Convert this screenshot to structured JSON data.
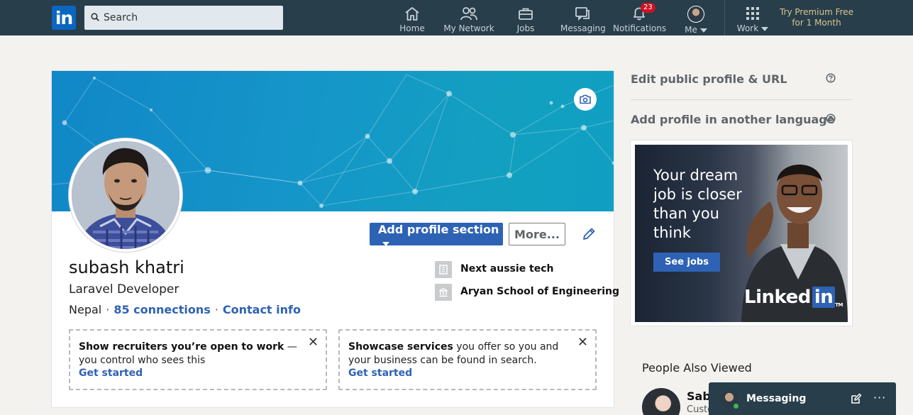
{
  "nav": {
    "logo": "in",
    "search_placeholder": "Search",
    "items": [
      {
        "label": "Home",
        "icon": "home-icon"
      },
      {
        "label": "My Network",
        "icon": "network-icon"
      },
      {
        "label": "Jobs",
        "icon": "briefcase-icon"
      },
      {
        "label": "Messaging",
        "icon": "messaging-icon"
      },
      {
        "label": "Notifications",
        "icon": "bell-icon"
      },
      {
        "label": "Me",
        "icon": "avatar"
      },
      {
        "label": "Work",
        "icon": "grid-icon"
      }
    ],
    "notifications_count": "23",
    "premium_line1": "Try Premium Free",
    "premium_line2": "for 1 Month"
  },
  "profile": {
    "name": "subash khatri",
    "headline": "Laravel Developer",
    "location": "Nepal",
    "connections": "85 connections",
    "contact": "Contact info",
    "add_section_label": "Add profile section",
    "more_label": "More...",
    "experience": [
      {
        "name": "Next aussie tech",
        "icon": "company-icon"
      },
      {
        "name": "Aryan School of Engineering",
        "icon": "school-icon"
      }
    ],
    "promos": [
      {
        "bold": "Show recruiters you’re open to work",
        "rest": " — you control who sees this",
        "cta": "Get started"
      },
      {
        "bold": "Showcase services",
        "rest": " you offer so you and your business can be found in search.",
        "cta": "Get started"
      }
    ]
  },
  "rail": {
    "edit_public": "Edit public profile & URL",
    "add_language": "Add profile in another language",
    "ad": {
      "line1": "Your dream",
      "line2": "job is closer",
      "line3": "than you",
      "line4": "think",
      "button": "See jobs",
      "logo_text": "Linked",
      "logo_in": "in",
      "logo_tm": "TM"
    },
    "people_also_viewed": "People Also Viewed",
    "person_name": "Sabi",
    "person_sub": "Custo"
  },
  "messaging": {
    "label": "Messaging",
    "more": "···"
  },
  "colors": {
    "nav_bg": "#283e4a",
    "primary": "#2e62b5",
    "banner": "#1596c9",
    "page_bg": "#f3f2ef"
  }
}
